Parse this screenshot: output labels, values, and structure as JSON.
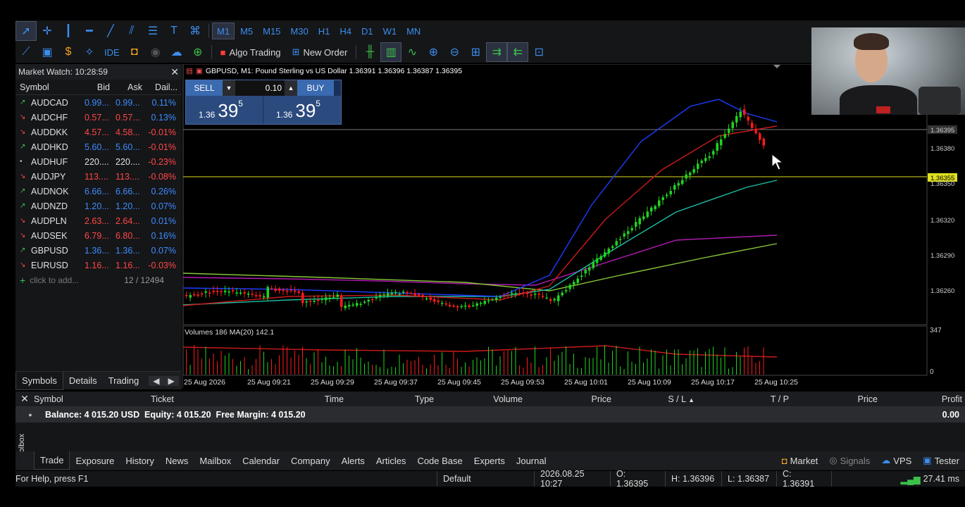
{
  "timeframes": [
    "M1",
    "M5",
    "M15",
    "M30",
    "H1",
    "H4",
    "D1",
    "W1",
    "MN"
  ],
  "selected_timeframe": "M1",
  "toolbar2": {
    "ide": "IDE",
    "algo": "Algo Trading",
    "new_order": "New Order"
  },
  "market_watch": {
    "title": "Market Watch: 10:28:59",
    "headers": {
      "symbol": "Symbol",
      "bid": "Bid",
      "ask": "Ask",
      "daily": "Dail..."
    },
    "rows": [
      {
        "sym": "AUDCAD",
        "bid": "0.99...",
        "ask": "0.99...",
        "daily": "0.11%",
        "dir": "up"
      },
      {
        "sym": "AUDCHF",
        "bid": "0.57...",
        "ask": "0.57...",
        "daily": "0.13%",
        "dir": "dn"
      },
      {
        "sym": "AUDDKK",
        "bid": "4.57...",
        "ask": "4.58...",
        "daily": "-0.01%",
        "dir": "dn"
      },
      {
        "sym": "AUDHKD",
        "bid": "5.60...",
        "ask": "5.60...",
        "daily": "-0.01%",
        "dir": "up"
      },
      {
        "sym": "AUDHUF",
        "bid": "220....",
        "ask": "220....",
        "daily": "-0.23%",
        "dir": "nu"
      },
      {
        "sym": "AUDJPY",
        "bid": "113....",
        "ask": "113....",
        "daily": "-0.08%",
        "dir": "dn"
      },
      {
        "sym": "AUDNOK",
        "bid": "6.66...",
        "ask": "6.66...",
        "daily": "0.26%",
        "dir": "up"
      },
      {
        "sym": "AUDNZD",
        "bid": "1.20...",
        "ask": "1.20...",
        "daily": "0.07%",
        "dir": "up"
      },
      {
        "sym": "AUDPLN",
        "bid": "2.63...",
        "ask": "2.64...",
        "daily": "0.01%",
        "dir": "dn"
      },
      {
        "sym": "AUDSEK",
        "bid": "6.79...",
        "ask": "6.80...",
        "daily": "0.16%",
        "dir": "dn"
      },
      {
        "sym": "GBPUSD",
        "bid": "1.36...",
        "ask": "1.36...",
        "daily": "0.07%",
        "dir": "up"
      },
      {
        "sym": "EURUSD",
        "bid": "1.16...",
        "ask": "1.16...",
        "daily": "-0.03%",
        "dir": "dn"
      }
    ],
    "add_label": "click to add...",
    "count": "12 / 12494",
    "tabs": [
      "Symbols",
      "Details",
      "Trading"
    ]
  },
  "chart": {
    "title": "GBPUSD, M1:  Pound Sterling vs US Dollar  1.36391 1.36396 1.36387 1.36395",
    "sell_label": "SELL",
    "buy_label": "BUY",
    "lot": "0.10",
    "sell_price_small": "1.36",
    "sell_price_big": "39",
    "sell_price_sup": "5",
    "buy_price_small": "1.36",
    "buy_price_big": "39",
    "buy_price_sup": "5",
    "price_labels": [
      "1.36395",
      "1.36380",
      "1.36355",
      "1.36350",
      "1.36320",
      "1.36290",
      "1.36260"
    ],
    "volume_label": "Volumes 186 MA(20) 142.1",
    "volume_axis": [
      "347",
      "0"
    ],
    "time_labels": [
      "25 Aug 2026",
      "25 Aug 09:21",
      "25 Aug 09:29",
      "25 Aug 09:37",
      "25 Aug 09:45",
      "25 Aug 09:53",
      "25 Aug 10:01",
      "25 Aug 10:09",
      "25 Aug 10:17",
      "25 Aug 10:25"
    ],
    "colors": {
      "bull": "#1fd41f",
      "bear": "#ff1a1a",
      "ma_blue": "#1e3cff",
      "ma_red": "#cc1a1a",
      "ma_teal": "#1bbfa6",
      "ma_magenta": "#b01ab0",
      "ma_green": "#88c93a",
      "hline": "#e0e020"
    }
  },
  "terminal": {
    "headers": [
      "Symbol",
      "Ticket",
      "Time",
      "Type",
      "Volume",
      "Price",
      "S / L",
      "T / P",
      "Price",
      "Profit"
    ],
    "balance": "Balance: 4 015.20 USD  Equity: 4 015.20  Free Margin: 4 015.20",
    "profit": "0.00",
    "tabs": [
      "Trade",
      "Exposure",
      "History",
      "News",
      "Mailbox",
      "Calendar",
      "Company",
      "Alerts",
      "Articles",
      "Code Base",
      "Experts",
      "Journal"
    ],
    "right_tabs": [
      "Market",
      "Signals",
      "VPS",
      "Tester"
    ],
    "side_label": "Toolbox"
  },
  "status": {
    "help": "For Help, press F1",
    "profile": "Default",
    "datetime": "2026.08.25 10:27",
    "open": "O: 1.36395",
    "high": "H: 1.36396",
    "low": "L: 1.36387",
    "close": "C: 1.36391",
    "ping": "27.41 ms"
  }
}
